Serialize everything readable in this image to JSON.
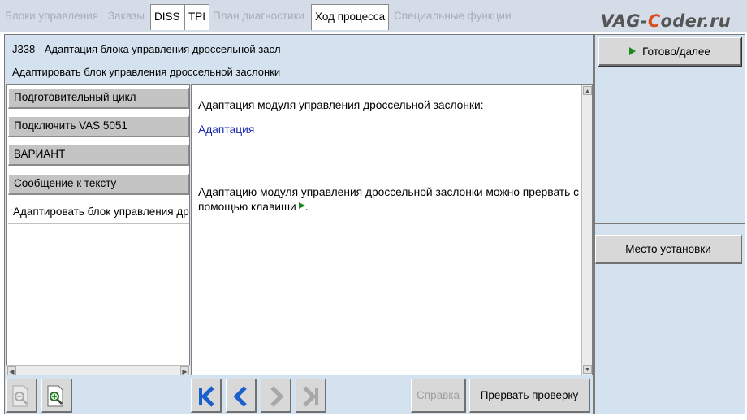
{
  "tabs": [
    {
      "label": "Блоки управления",
      "state": "disabled"
    },
    {
      "label": "Заказы",
      "state": "disabled"
    },
    {
      "label": "DISS",
      "state": "enabled"
    },
    {
      "label": "TPI",
      "state": "enabled"
    },
    {
      "label": "План диагностики",
      "state": "disabled"
    },
    {
      "label": "Ход процесса",
      "state": "active"
    },
    {
      "label": "Специальные функции",
      "state": "disabled"
    }
  ],
  "brand": {
    "prefix": "VAG-",
    "accent": "C",
    "suffix": "oder.ru"
  },
  "header": {
    "line1": "J338 - Адаптация блока управления дроссельной засл",
    "line2": "Адаптировать блок управления дроссельной заслонки"
  },
  "steps": [
    {
      "label": "Подготовительный цикл"
    },
    {
      "label": "Подключить VAS 5051"
    },
    {
      "label": "ВАРИАНТ"
    },
    {
      "label": "Сообщение к тексту"
    },
    {
      "label": "Адаптировать блок управления дроссельной заслонки",
      "current": true
    }
  ],
  "content": {
    "line1": "Адаптация модуля управления дроссельной заслонки:",
    "link": "Адаптация",
    "para_line1": "Адаптацию модуля управления дроссельной заслонки можно прервать с",
    "para_line2_prefix": "помощью клавиши",
    "para_line2_suffix": "."
  },
  "buttons": {
    "next": "Готово/далее",
    "location": "Место установки",
    "help": "Справка",
    "abort": "Прервать проверку"
  },
  "icons": {
    "zoom_out": "zoom-out-icon",
    "zoom_in": "zoom-in-icon",
    "first": "skip-to-first-icon",
    "back": "back-arrow-icon",
    "forward": "forward-arrow-icon",
    "last": "skip-to-last-icon"
  },
  "colors": {
    "panel_bg": "#d4e2f0",
    "button_bg": "#d8d8d8",
    "link": "#1a2ab0",
    "nav_active": "#1a5fcc",
    "nav_disabled": "#a8a8a8",
    "play": "#1a8a1a",
    "brand_accent": "#d94e1f"
  }
}
